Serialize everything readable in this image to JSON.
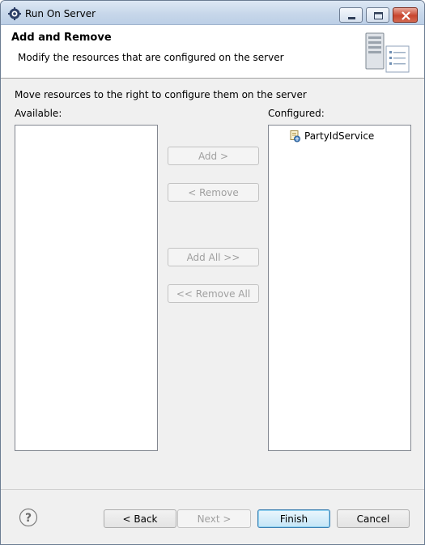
{
  "window": {
    "title": "Run On Server"
  },
  "header": {
    "title": "Add and Remove",
    "description": "Modify the resources that are configured on the server"
  },
  "body": {
    "instruction": "Move resources to the right to configure them on the server",
    "available_label": "Available:",
    "configured_label": "Configured:",
    "available_items": [],
    "configured_items": [
      "PartyIdService"
    ]
  },
  "buttons": {
    "add": "Add >",
    "remove": "< Remove",
    "add_all": "Add All >>",
    "remove_all": "<< Remove All"
  },
  "footer": {
    "back": "< Back",
    "next": "Next >",
    "finish": "Finish",
    "cancel": "Cancel"
  },
  "icons": {
    "app": "eclipse-gear-icon",
    "header": "server-icon",
    "item": "web-module-icon",
    "help": "help-icon"
  },
  "colors": {
    "titlebar": "#c7d7ea",
    "close_button": "#c8452e",
    "disabled_text": "#a0a0a0",
    "default_button_border": "#3c7fb1"
  }
}
